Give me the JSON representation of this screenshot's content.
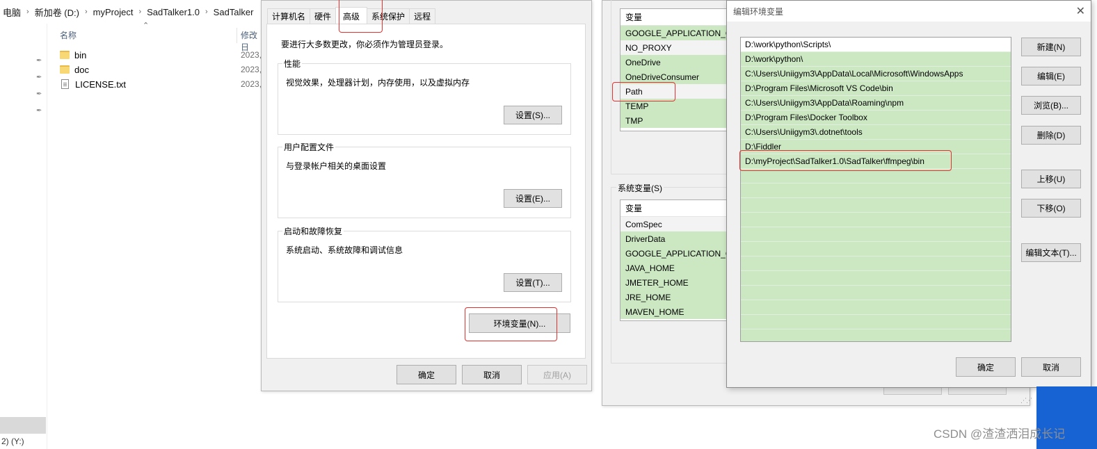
{
  "explorer": {
    "breadcrumb": [
      "电脑",
      "新加卷 (D:)",
      "myProject",
      "SadTalker1.0",
      "SadTalker"
    ],
    "columns": {
      "name": "名称",
      "date": "修改日"
    },
    "files": [
      {
        "name": "bin",
        "date": "2023,",
        "icon": "folder-icon"
      },
      {
        "name": "doc",
        "date": "2023,",
        "icon": "folder-icon"
      },
      {
        "name": "LICENSE.txt",
        "date": "2023,",
        "icon": "text-file-icon"
      }
    ],
    "drive_label": "2) (Y:)"
  },
  "sysprops": {
    "tabs": [
      "计算机名",
      "硬件",
      "高级",
      "系统保护",
      "远程"
    ],
    "active_tab": "高级",
    "admin_note": "要进行大多数更改，你必须作为管理员登录。",
    "groups": [
      {
        "title": "性能",
        "desc": "视觉效果，处理器计划，内存使用，以及虚拟内存",
        "button": "设置(S)..."
      },
      {
        "title": "用户配置文件",
        "desc": "与登录帐户相关的桌面设置",
        "button": "设置(E)..."
      },
      {
        "title": "启动和故障恢复",
        "desc": "系统启动、系统故障和调试信息",
        "button": "设置(T)..."
      }
    ],
    "env_button": "环境变量(N)...",
    "ok": "确定",
    "cancel": "取消",
    "apply": "应用(A)"
  },
  "envvars": {
    "user_vars_header": "变量",
    "user_vars": [
      "GOOGLE_APPLICATION_C",
      "NO_PROXY",
      "OneDrive",
      "OneDriveConsumer",
      "Path",
      "TEMP",
      "TMP"
    ],
    "selected_user_var": "Path",
    "system_title": "系统变量(S)",
    "system_vars_header": "变量",
    "system_vars": [
      "ComSpec",
      "DriverData",
      "GOOGLE_APPLICATION_C",
      "JAVA_HOME",
      "JMETER_HOME",
      "JRE_HOME",
      "MAVEN_HOME"
    ]
  },
  "editenv": {
    "title": "编辑环境变量",
    "paths": [
      "D:\\work\\python\\Scripts\\",
      "D:\\work\\python\\",
      "C:\\Users\\Uniigym3\\AppData\\Local\\Microsoft\\WindowsApps",
      "D:\\Program Files\\Microsoft VS Code\\bin",
      "C:\\Users\\Uniigym3\\AppData\\Roaming\\npm",
      "D:\\Program Files\\Docker Toolbox",
      "C:\\Users\\Uniigym3\\.dotnet\\tools",
      "D:\\Fiddler",
      "D:\\myProject\\SadTalker1.0\\SadTalker\\ffmpeg\\bin"
    ],
    "buttons": {
      "new": "新建(N)",
      "edit": "编辑(E)",
      "browse": "浏览(B)...",
      "delete": "删除(D)",
      "move_up": "上移(U)",
      "move_down": "下移(O)",
      "edit_text": "编辑文本(T)...",
      "ok": "确定",
      "cancel": "取消"
    }
  },
  "watermark": "CSDN @渣渣洒泪成长记",
  "colors": {
    "highlight_box": "#e4312f",
    "list_green": "#cce8c3",
    "taskbar_blue": "#1763d4"
  }
}
